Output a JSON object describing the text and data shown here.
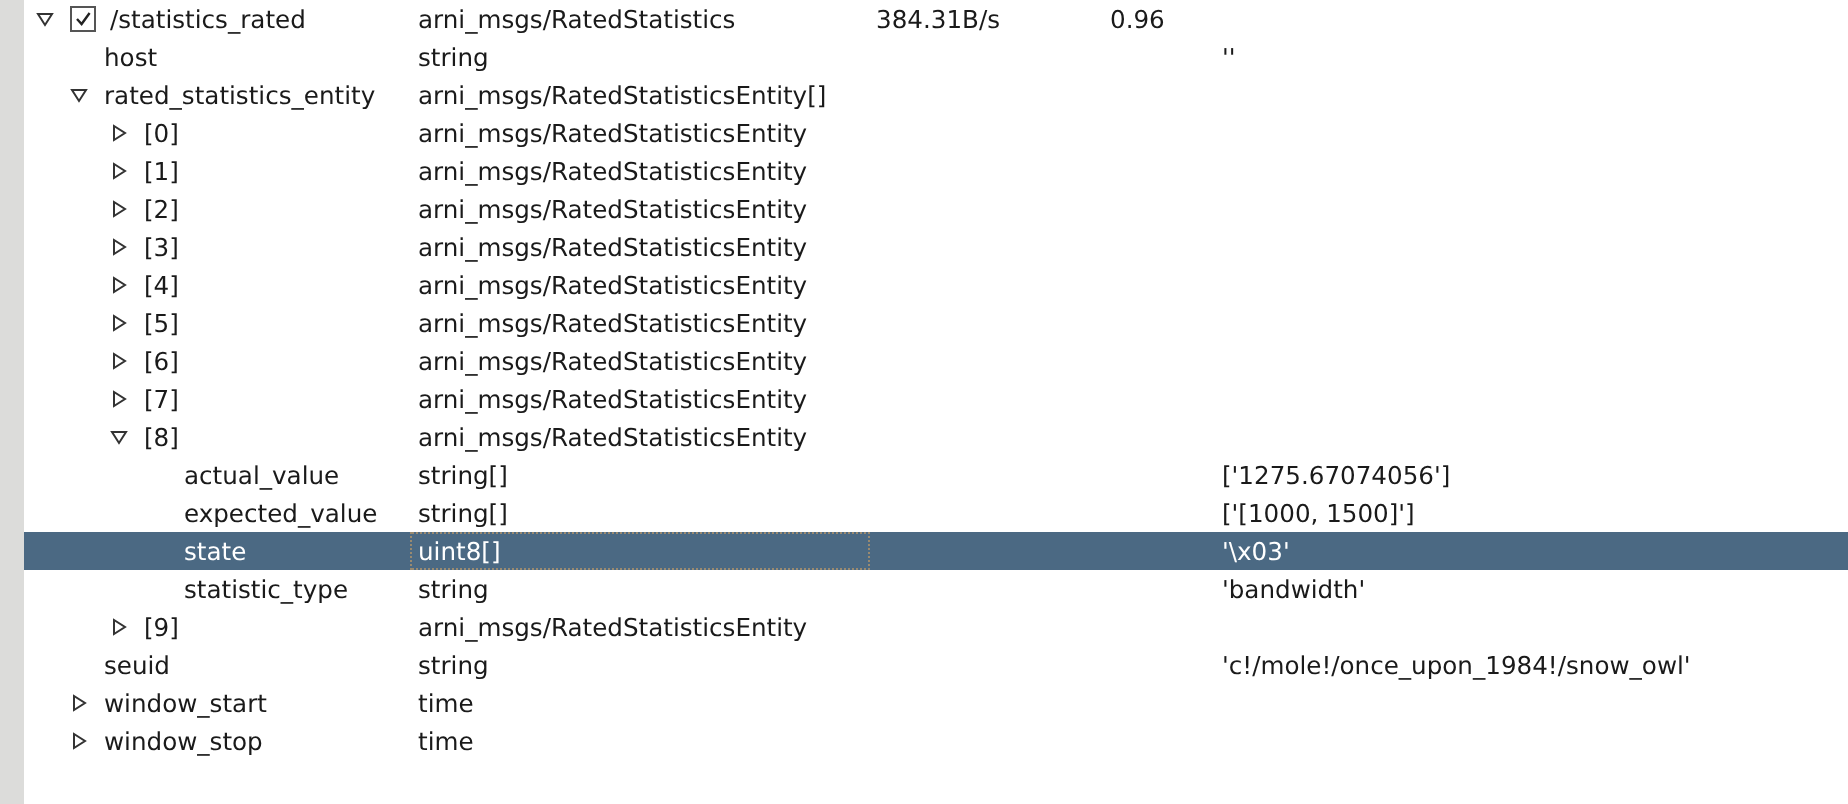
{
  "tree": [
    {
      "name": "/statistics_rated",
      "type": "arni_msgs/RatedStatistics",
      "bandwidth": "384.31B/s",
      "frequency": "0.96",
      "checked": true,
      "expanded": true,
      "selected": false,
      "children": [
        {
          "name": "host",
          "type": "string",
          "value": "''",
          "selected": false
        },
        {
          "name": "rated_statistics_entity",
          "type": "arni_msgs/RatedStatisticsEntity[]",
          "expanded": true,
          "selected": false,
          "children": [
            {
              "name": "[0]",
              "type": "arni_msgs/RatedStatisticsEntity",
              "expanded": false,
              "selected": false
            },
            {
              "name": "[1]",
              "type": "arni_msgs/RatedStatisticsEntity",
              "expanded": false,
              "selected": false
            },
            {
              "name": "[2]",
              "type": "arni_msgs/RatedStatisticsEntity",
              "expanded": false,
              "selected": false
            },
            {
              "name": "[3]",
              "type": "arni_msgs/RatedStatisticsEntity",
              "expanded": false,
              "selected": false
            },
            {
              "name": "[4]",
              "type": "arni_msgs/RatedStatisticsEntity",
              "expanded": false,
              "selected": false
            },
            {
              "name": "[5]",
              "type": "arni_msgs/RatedStatisticsEntity",
              "expanded": false,
              "selected": false
            },
            {
              "name": "[6]",
              "type": "arni_msgs/RatedStatisticsEntity",
              "expanded": false,
              "selected": false
            },
            {
              "name": "[7]",
              "type": "arni_msgs/RatedStatisticsEntity",
              "expanded": false,
              "selected": false
            },
            {
              "name": "[8]",
              "type": "arni_msgs/RatedStatisticsEntity",
              "expanded": true,
              "selected": false,
              "children": [
                {
                  "name": "actual_value",
                  "type": "string[]",
                  "value": "['1275.67074056']",
                  "selected": false
                },
                {
                  "name": "expected_value",
                  "type": "string[]",
                  "value": "['[1000, 1500]']",
                  "selected": false
                },
                {
                  "name": "state",
                  "type": "uint8[]",
                  "value": "'\\x03'",
                  "selected": true
                },
                {
                  "name": "statistic_type",
                  "type": "string",
                  "value": "'bandwidth'",
                  "selected": false
                }
              ]
            },
            {
              "name": "[9]",
              "type": "arni_msgs/RatedStatisticsEntity",
              "expanded": false,
              "selected": false
            }
          ]
        },
        {
          "name": "seuid",
          "type": "string",
          "value": "'c!/mole!/once_upon_1984!/snow_owl'",
          "selected": false
        },
        {
          "name": "window_start",
          "type": "time",
          "expanded": false,
          "selected": false
        },
        {
          "name": "window_stop",
          "type": "time",
          "expanded": false,
          "selected": false
        }
      ]
    }
  ]
}
